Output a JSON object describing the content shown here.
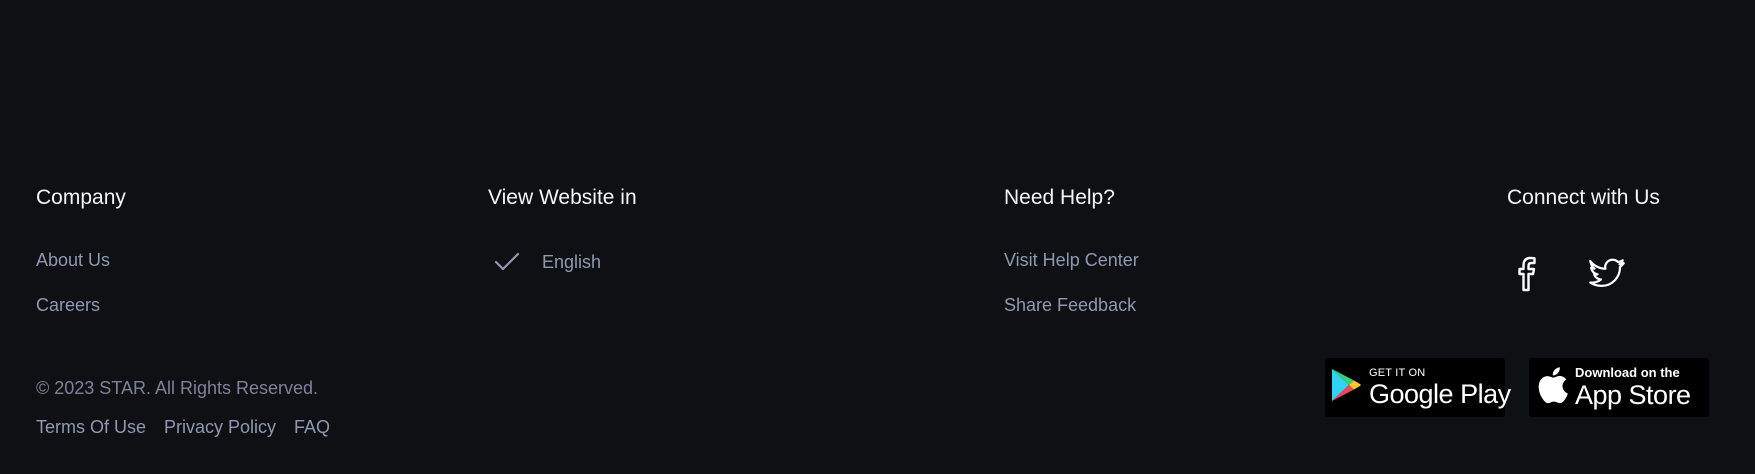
{
  "company": {
    "heading": "Company",
    "links": [
      "About Us",
      "Careers"
    ]
  },
  "language": {
    "heading": "View Website in",
    "selected": "English",
    "icon": "check-icon"
  },
  "help": {
    "heading": "Need Help?",
    "links": [
      "Visit Help Center",
      "Share Feedback"
    ]
  },
  "connect": {
    "heading": "Connect with Us",
    "icons": [
      "facebook-icon",
      "twitter-icon"
    ]
  },
  "footer": {
    "copyright": "© 2023 STAR. All Rights Reserved.",
    "legal_links": [
      "Terms Of Use",
      "Privacy Policy",
      "FAQ"
    ]
  },
  "badges": {
    "google": {
      "small": "GET IT ON",
      "big": "Google Play"
    },
    "apple": {
      "small": "Download on the",
      "big": "App Store"
    }
  },
  "colors": {
    "background": "#0f1014",
    "heading": "#f2f4f8",
    "link": "#8f98b2"
  }
}
